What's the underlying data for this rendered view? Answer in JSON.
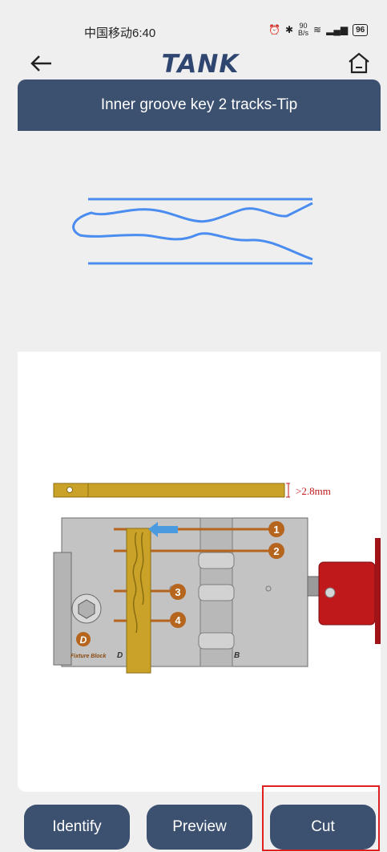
{
  "status_bar": {
    "carrier_time": "中国移动6:40",
    "speed_top": "90",
    "speed_unit": "B/s",
    "battery": "96"
  },
  "app_bar": {
    "logo": "TANK"
  },
  "title": "Inner groove key 2 tracks-Tip",
  "diagram": {
    "thickness_label": ">2.8mm",
    "slots": [
      "1",
      "2",
      "3",
      "4"
    ],
    "block_label": "D",
    "block_name": "Fixture Block",
    "letter_d": "D",
    "letter_b": "B"
  },
  "buttons": {
    "identify": "Identify",
    "preview": "Preview",
    "cut": "Cut"
  },
  "colors": {
    "accent": "#3c5070",
    "key_outline": "#4a8cf0",
    "key_brass": "#c9a227",
    "clamp_red": "#c0191c",
    "highlight": "#e02020"
  }
}
